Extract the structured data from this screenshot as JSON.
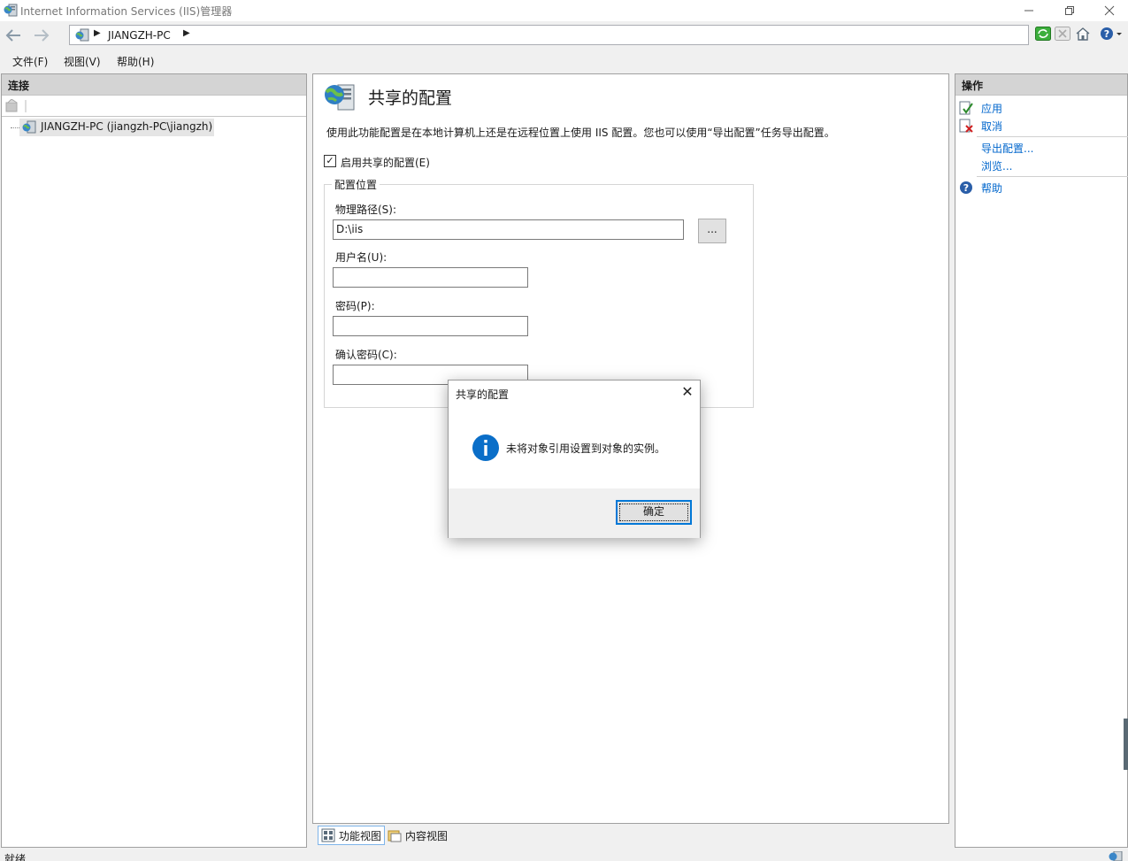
{
  "window": {
    "title": "Internet Information Services (IIS)管理器",
    "minimize_icon": "minimize-icon",
    "restore_icon": "restore-icon",
    "close_icon": "close-icon"
  },
  "address_bar": {
    "breadcrumb": "JIANGZH-PC"
  },
  "menu": [
    "文件(F)",
    "视图(V)",
    "帮助(H)"
  ],
  "connections": {
    "header": "连接",
    "tree_node": "JIANGZH-PC (jiangzh-PC\\jiangzh)"
  },
  "feature": {
    "title": "共享的配置",
    "description": "使用此功能配置是在本地计算机上还是在远程位置上使用 IIS 配置。您也可以使用“导出配置”任务导出配置。",
    "enable_label": "启用共享的配置(E)",
    "enable_checked": true,
    "checkmark": "✓",
    "group_title": "配置位置",
    "path_label": "物理路径(S):",
    "path_value": "D:\\iis",
    "browse_label": "...",
    "username_label": "用户名(U):",
    "username_value": "",
    "password_label": "密码(P):",
    "password_value": "",
    "confirm_label": "确认密码(C):",
    "confirm_value": ""
  },
  "tabs": [
    {
      "label": "功能视图",
      "active": true
    },
    {
      "label": "内容视图",
      "active": false
    }
  ],
  "actions": {
    "header": "操作",
    "items": [
      "应用",
      "取消",
      "导出配置...",
      "浏览...",
      "帮助"
    ]
  },
  "status": {
    "text": "就绪"
  },
  "dialog": {
    "title": "共享的配置",
    "message": "未将对象引用设置到对象的实例。",
    "ok_label": "确定",
    "close_glyph": "✕",
    "info_glyph": "i"
  },
  "colors": {
    "accent": "#0078d7",
    "link": "#0066cc",
    "info_blue": "#0a6ec8"
  }
}
